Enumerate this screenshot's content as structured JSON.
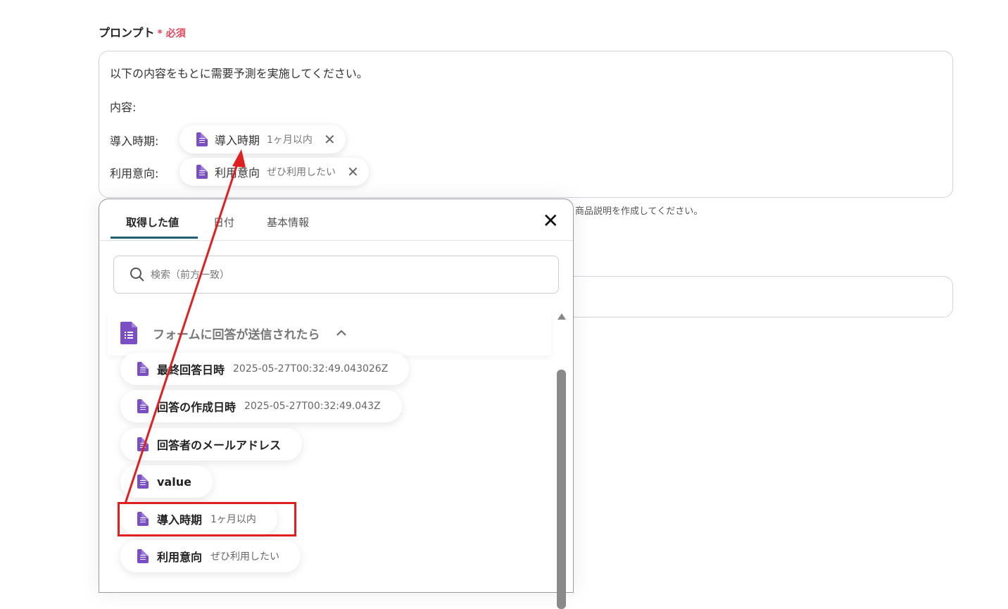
{
  "prompt_field": {
    "label": "プロンプト",
    "required_mark": "*",
    "required_text": "必須",
    "lines": [
      "以下の内容をもとに需要予測を実施してください。",
      "内容:",
      "導入時期:",
      "利用意向:"
    ],
    "chips": [
      {
        "name": "導入時期",
        "value": "1ヶ月以内",
        "remove": "✕"
      },
      {
        "name": "利用意向",
        "value": "ぜひ利用したい",
        "remove": "✕"
      }
    ]
  },
  "helper_text": "商品説明を作成してください。",
  "panel": {
    "tabs": [
      "取得した値",
      "日付",
      "基本情報"
    ],
    "close": "✕",
    "search_placeholder": "検索（前方一致）",
    "group_title": "フォームに回答が送信されたら",
    "items": [
      {
        "name": "最終回答日時",
        "value": "2025-05-27T00:32:49.043026Z"
      },
      {
        "name": "回答の作成日時",
        "value": "2025-05-27T00:32:49.043Z"
      },
      {
        "name": "回答者のメールアドレス",
        "value": ""
      },
      {
        "name": "value",
        "value": ""
      },
      {
        "name": "導入時期",
        "value": "1ヶ月以内"
      },
      {
        "name": "利用意向",
        "value": "ぜひ利用したい"
      }
    ]
  },
  "colors": {
    "accent": "#1f5f6e",
    "forms_icon": "#7a4fc4",
    "required": "#e8455a",
    "annotation": "#e02020"
  }
}
